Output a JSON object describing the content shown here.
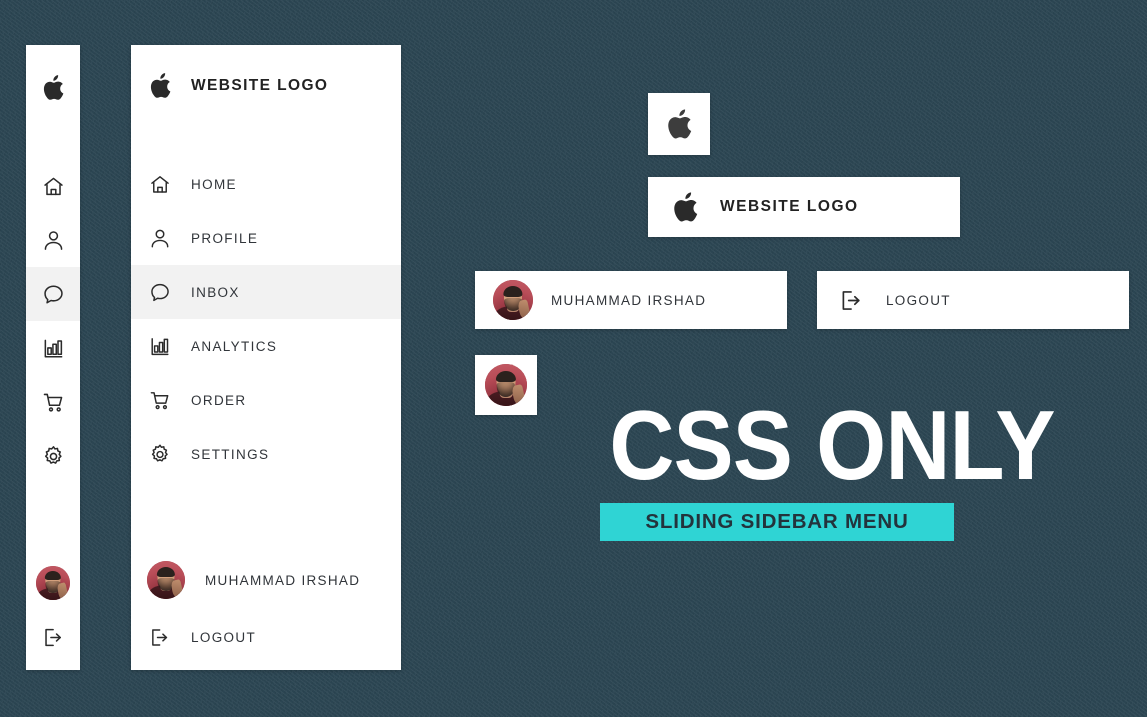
{
  "theme": {
    "background_color": "#2b4552",
    "panel_color": "#ffffff",
    "accent_color": "#2fd4d4",
    "active_row_color": "#f2f2f2",
    "text_color": "#31353a"
  },
  "brand": {
    "logo_icon": "apple-logo-icon",
    "name": "WEBSITE LOGO"
  },
  "nav": {
    "items": [
      {
        "icon": "home-icon",
        "label": "HOME",
        "active": false
      },
      {
        "icon": "person-icon",
        "label": "PROFILE",
        "active": false
      },
      {
        "icon": "chat-icon",
        "label": "INBOX",
        "active": true
      },
      {
        "icon": "analytics-icon",
        "label": "ANALYTICS",
        "active": false
      },
      {
        "icon": "cart-icon",
        "label": "ORDER",
        "active": false
      },
      {
        "icon": "gear-icon",
        "label": "SETTINGS",
        "active": false
      }
    ]
  },
  "account": {
    "avatar_icon": "user-avatar",
    "user_name": "MUHAMMAD IRSHAD",
    "logout_icon": "logout-icon",
    "logout_label": "LOGOUT"
  },
  "callouts": {
    "logo_icon_card": {
      "icon": "apple-logo-icon"
    },
    "logo_full_card": {
      "icon": "apple-logo-icon",
      "label": "WEBSITE LOGO"
    },
    "user_card": {
      "avatar": "user-avatar",
      "label": "MUHAMMAD IRSHAD"
    },
    "logout_card": {
      "icon": "logout-icon",
      "label": "LOGOUT"
    },
    "avatar_card": {
      "avatar": "user-avatar"
    }
  },
  "hero": {
    "title": "CSS ONLY",
    "subtitle": "SLIDING SIDEBAR MENU"
  }
}
